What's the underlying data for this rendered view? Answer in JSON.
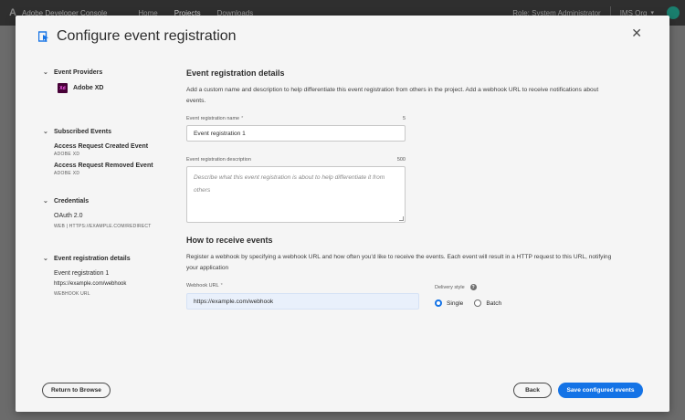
{
  "topbar": {
    "app_title": "Adobe Developer Console",
    "nav": [
      "Home",
      "Projects",
      "Downloads"
    ],
    "role": "Role: System Administrator",
    "org": "IMS Org"
  },
  "modal": {
    "title": "Configure event registration",
    "close_label": "✕"
  },
  "sidebar": {
    "event_providers": {
      "heading": "Event Providers",
      "provider_badge": "Xd",
      "provider": "Adobe XD"
    },
    "subscribed_events": {
      "heading": "Subscribed Events",
      "items": [
        {
          "title": "Access Request Created Event",
          "sub": "ADOBE XD"
        },
        {
          "title": "Access Request Removed Event",
          "sub": "ADOBE XD"
        }
      ]
    },
    "credentials": {
      "heading": "Credentials",
      "name": "OAuth 2.0",
      "detail": "WEB | HTTPS://EXAMPLE.COM/REDIRECT"
    },
    "registration_details": {
      "heading": "Event registration details",
      "name": "Event registration 1",
      "url": "https://example.com/webhook",
      "url_label": "WEBHOOK URL"
    }
  },
  "main": {
    "details_title": "Event registration details",
    "details_desc": "Add a custom name and description to help differentiate this event registration from others in the project. Add a webhook URL to receive notifications about events.",
    "name_label": "Event registration name",
    "name_required": "*",
    "name_counter": "5",
    "name_value": "Event registration 1",
    "desc_label": "Event registration description",
    "desc_counter": "500",
    "desc_placeholder": "Describe what this event registration is about to help differentiate it from others",
    "receive_title": "How to receive events",
    "receive_desc": "Register a webhook by specifying a webhook URL and how often you'd like to receive the events. Each event will result in a HTTP request to this URL, notifying your application",
    "webhook_label": "Webhook URL",
    "webhook_required": "*",
    "webhook_value": "https://example.com/webhook",
    "delivery_label": "Delivery style",
    "delivery_options": [
      {
        "label": "Single",
        "selected": true
      },
      {
        "label": "Batch",
        "selected": false
      }
    ]
  },
  "footer": {
    "return_label": "Return to Browse",
    "back_label": "Back",
    "save_label": "Save configured events"
  },
  "colors": {
    "accent": "#1473e6",
    "modal_bg": "#f5f5f5",
    "topbar_bg": "#2f2f2f"
  }
}
